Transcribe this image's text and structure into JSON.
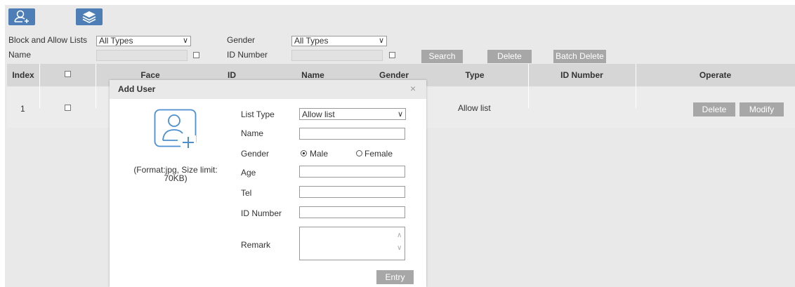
{
  "toolbar": {
    "add_icon": "add-user-icon",
    "layers_icon": "layers-icon",
    "accent": "#4d7fb6"
  },
  "filters": {
    "list_label": "Block and Allow Lists",
    "list_value": "All Types",
    "gender_label": "Gender",
    "gender_value": "All Types",
    "name_label": "Name",
    "id_label": "ID Number",
    "search": "Search",
    "delete": "Delete",
    "batch_delete": "Batch Delete"
  },
  "table": {
    "headers": [
      "Index",
      "Face",
      "ID",
      "Name",
      "Gender",
      "Type",
      "ID Number",
      "Operate"
    ],
    "rows": [
      {
        "index": "1",
        "type": "Allow list",
        "id_number": "",
        "delete": "Delete",
        "modify": "Modify"
      }
    ]
  },
  "modal": {
    "title": "Add User",
    "close": "×",
    "photo_icon": "add-photo-icon",
    "hint_line1": "(Format:jpg, Size limit:",
    "hint_line2": "70KB)",
    "list_type_label": "List Type",
    "list_type_value": "Allow list",
    "name_label": "Name",
    "gender_label": "Gender",
    "male": "Male",
    "female": "Female",
    "gender_selected": "Male",
    "age_label": "Age",
    "tel_label": "Tel",
    "id_label": "ID Number",
    "remark_label": "Remark",
    "entry": "Entry"
  }
}
